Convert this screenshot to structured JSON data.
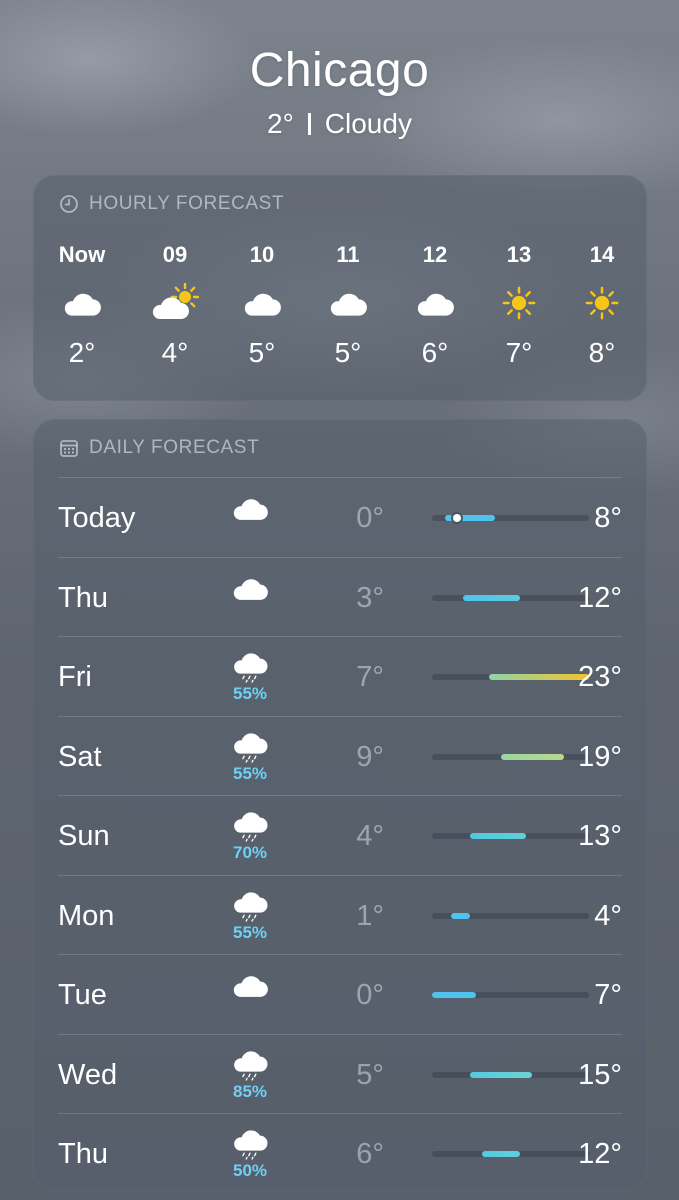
{
  "location": {
    "city": "Chicago",
    "temp": "2°",
    "condition": "Cloudy"
  },
  "hourly": {
    "title": "HOURLY FORECAST",
    "items": [
      {
        "time": "Now",
        "icon": "cloud-icon",
        "temp": "2°"
      },
      {
        "time": "09",
        "icon": "partly-sunny-icon",
        "temp": "4°"
      },
      {
        "time": "10",
        "icon": "cloud-icon",
        "temp": "5°"
      },
      {
        "time": "11",
        "icon": "cloud-icon",
        "temp": "5°"
      },
      {
        "time": "12",
        "icon": "cloud-icon",
        "temp": "6°"
      },
      {
        "time": "13",
        "icon": "sun-icon",
        "temp": "7°"
      },
      {
        "time": "14",
        "icon": "sun-icon",
        "temp": "8°"
      }
    ]
  },
  "daily": {
    "title": "DAILY FORECAST",
    "range": {
      "min": -2,
      "max": 23
    },
    "items": [
      {
        "day": "Today",
        "icon": "cloud-icon",
        "precip": "",
        "low": "0°",
        "high": "8°",
        "low_val": 0,
        "high_val": 8,
        "current_val": 2,
        "colors": [
          "#4fc3ee",
          "#4fc3ee"
        ]
      },
      {
        "day": "Thu",
        "icon": "cloud-icon",
        "precip": "",
        "low": "3°",
        "high": "12°",
        "low_val": 3,
        "high_val": 12,
        "colors": [
          "#4fc3ee",
          "#5ccbe0"
        ]
      },
      {
        "day": "Fri",
        "icon": "rain-cloud-icon",
        "precip": "55%",
        "low": "7°",
        "high": "23°",
        "low_val": 7,
        "high_val": 23,
        "colors": [
          "#8fd4a8",
          "#f5c22a"
        ]
      },
      {
        "day": "Sat",
        "icon": "rain-cloud-icon",
        "precip": "55%",
        "low": "9°",
        "high": "19°",
        "low_val": 9,
        "high_val": 19,
        "colors": [
          "#9cd5a0",
          "#b7d98a"
        ]
      },
      {
        "day": "Sun",
        "icon": "rain-cloud-icon",
        "precip": "70%",
        "low": "4°",
        "high": "13°",
        "low_val": 4,
        "high_val": 13,
        "colors": [
          "#4fc8e0",
          "#60d0d8"
        ]
      },
      {
        "day": "Mon",
        "icon": "rain-cloud-icon",
        "precip": "55%",
        "low": "1°",
        "high": "4°",
        "low_val": 1,
        "high_val": 4,
        "colors": [
          "#4fc3ee",
          "#4fc3ee"
        ]
      },
      {
        "day": "Tue",
        "icon": "cloud-icon",
        "precip": "",
        "low": "0°",
        "high": "7°",
        "low_val": -2,
        "high_val": 5,
        "colors": [
          "#4fc3ee",
          "#4fc3ee"
        ]
      },
      {
        "day": "Wed",
        "icon": "rain-cloud-icon",
        "precip": "85%",
        "low": "5°",
        "high": "15°",
        "low_val": 4,
        "high_val": 14,
        "colors": [
          "#55c9e4",
          "#6ed3d0"
        ]
      },
      {
        "day": "Thu",
        "icon": "rain-cloud-icon",
        "precip": "50%",
        "low": "6°",
        "high": "12°",
        "low_val": 6,
        "high_val": 12,
        "colors": [
          "#55c9e4",
          "#62cfd9"
        ]
      }
    ]
  },
  "colors": {
    "precip": "#6fd0f5",
    "sun": "#f5c518"
  }
}
